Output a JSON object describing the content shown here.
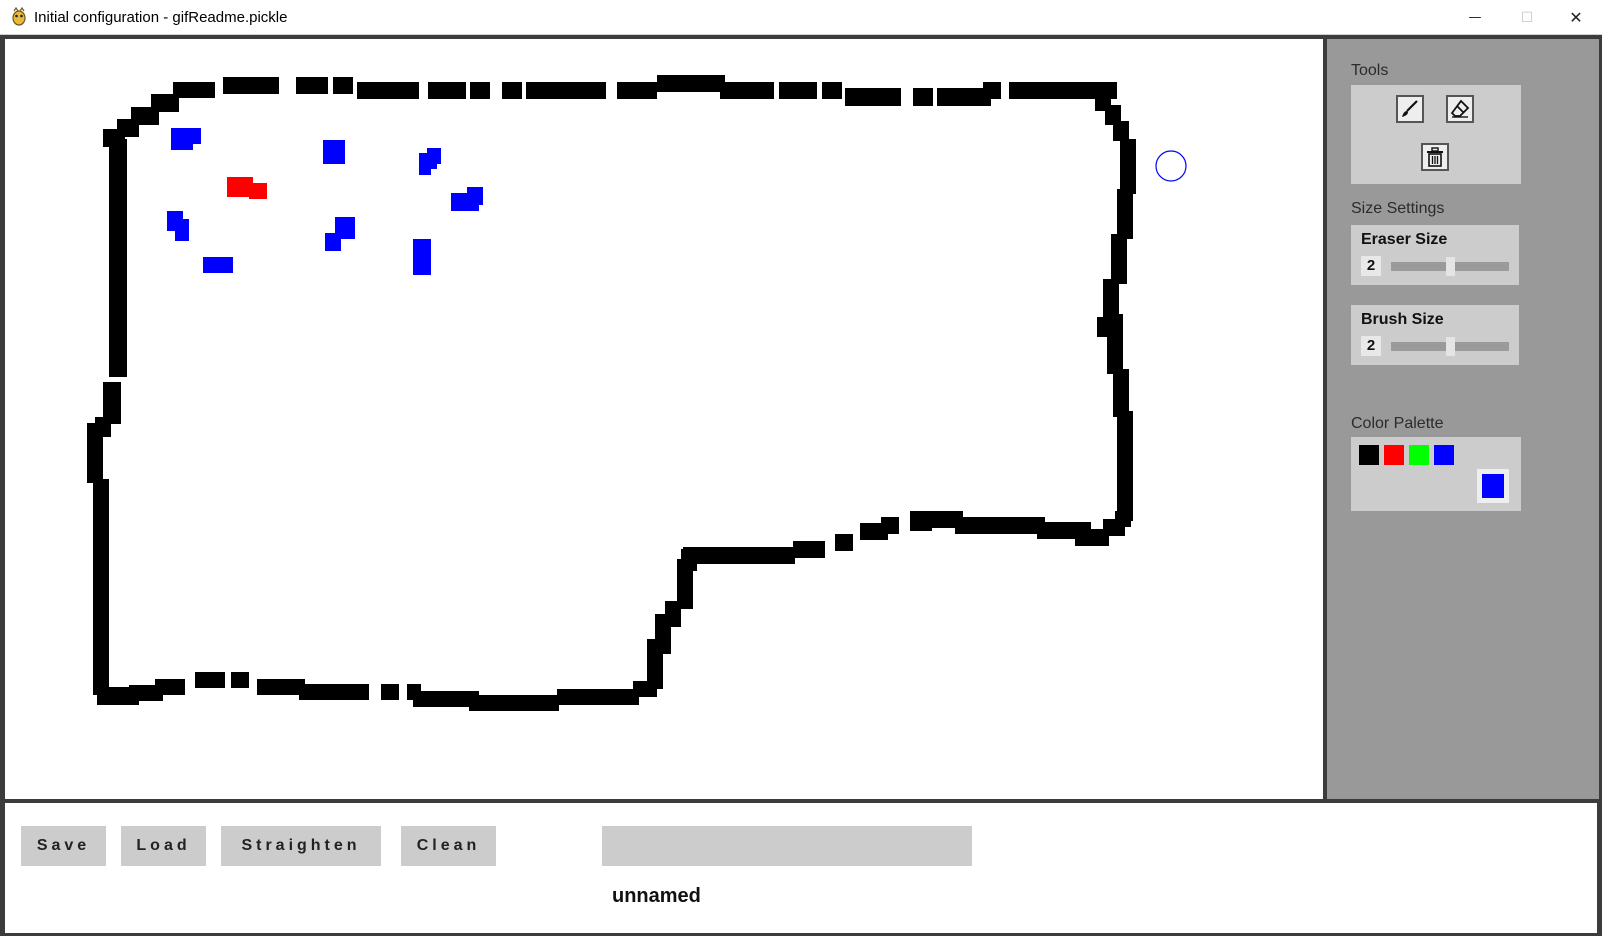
{
  "window": {
    "title": "Initial configuration - gifReadme.pickle",
    "app_icon": "pygame-snake-icon",
    "minimize_glyph": "—",
    "maximize_glyph": "☐",
    "close_glyph": "✕"
  },
  "sidebar": {
    "tools_title": "Tools",
    "tools": [
      {
        "name": "brush",
        "icon": "brush-icon"
      },
      {
        "name": "eraser",
        "icon": "eraser-icon"
      },
      {
        "name": "clear",
        "icon": "trash-icon"
      }
    ],
    "size_title": "Size Settings",
    "eraser_label": "Eraser Size",
    "eraser_value": "2",
    "eraser_level": 0.5,
    "brush_label": "Brush Size",
    "brush_value": "2",
    "brush_level": 0.5,
    "palette_title": "Color Palette",
    "palette": [
      "#000000",
      "#ff0000",
      "#00ff00",
      "#0000ff"
    ],
    "selected_color": "#0000ff"
  },
  "toolbar": {
    "save_label": "Save",
    "load_label": "Load",
    "straighten_label": "Straighten",
    "clean_label": "Clean",
    "filename_value": "",
    "filename_label": "unnamed"
  },
  "canvas": {
    "background": "#ffffff",
    "track_color": "#000000",
    "cone_colors": {
      "blue": "#0000ff",
      "red": "#ff0000"
    }
  }
}
